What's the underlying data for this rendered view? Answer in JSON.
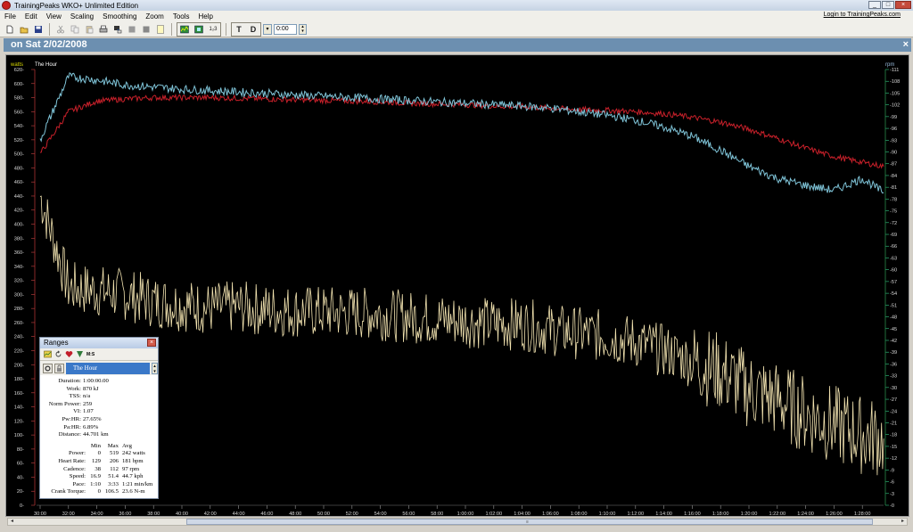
{
  "window": {
    "title": "TrainingPeaks WKO+ Unlimited Edition",
    "controls": [
      "_",
      "□",
      "×"
    ]
  },
  "menu": {
    "items": [
      "File",
      "Edit",
      "View",
      "Scaling",
      "Smoothing",
      "Zoom",
      "Tools",
      "Help"
    ],
    "login_link": "Login to TrainingPeaks.com"
  },
  "toolbar": {
    "time_input": "0:00",
    "t_label": "T",
    "d_label": "D",
    "zoom_label": "1₂3",
    "help_label": "?"
  },
  "panel": {
    "title": "on Sat 2/02/2008",
    "close": "×"
  },
  "chart_labels": {
    "left_unit": "watts",
    "right_unit": "rpm",
    "range_name": "The Hour",
    "left_ticks": [
      "620",
      "600",
      "580",
      "560",
      "540",
      "520",
      "500",
      "480",
      "460",
      "440",
      "420",
      "400",
      "380",
      "360",
      "340",
      "320",
      "300",
      "280",
      "260",
      "240",
      "220",
      "200",
      "180",
      "160",
      "140",
      "120",
      "100",
      "80",
      "60",
      "40",
      "20",
      "0"
    ],
    "right_ticks": [
      "111",
      "108",
      "105",
      "102",
      "99",
      "96",
      "93",
      "90",
      "87",
      "84",
      "81",
      "78",
      "75",
      "72",
      "69",
      "66",
      "63",
      "60",
      "57",
      "54",
      "51",
      "48",
      "45",
      "42",
      "39",
      "36",
      "33",
      "30",
      "27",
      "24",
      "21",
      "18",
      "15",
      "12",
      "9",
      "6",
      "3",
      "0"
    ],
    "x_ticks": [
      "30:00",
      "32:00",
      "34:00",
      "36:00",
      "38:00",
      "40:00",
      "42:00",
      "44:00",
      "46:00",
      "48:00",
      "50:00",
      "52:00",
      "54:00",
      "56:00",
      "58:00",
      "1:00:00",
      "1:02:00",
      "1:04:00",
      "1:06:00",
      "1:08:00",
      "1:10:00",
      "1:12:00",
      "1:14:00",
      "1:16:00",
      "1:18:00",
      "1:20:00",
      "1:22:00",
      "1:24:00",
      "1:26:00",
      "1:28:00"
    ]
  },
  "chart_data": {
    "type": "line",
    "x_unit": "elapsed time",
    "series": [
      {
        "name": "Power",
        "color": "#f2e3b0",
        "axis": "watts",
        "x": [
          "30:00",
          "32:00",
          "34:00",
          "36:00",
          "38:00",
          "40:00",
          "42:00",
          "44:00",
          "46:00",
          "48:00",
          "50:00",
          "52:00",
          "54:00",
          "56:00",
          "58:00",
          "1:00:00",
          "1:02:00",
          "1:04:00",
          "1:06:00",
          "1:08:00",
          "1:10:00",
          "1:12:00",
          "1:14:00",
          "1:16:00",
          "1:18:00",
          "1:20:00",
          "1:22:00",
          "1:24:00",
          "1:26:00",
          "1:28:00",
          "1:29:30"
        ],
        "values": [
          440,
          310,
          305,
          300,
          290,
          285,
          280,
          282,
          278,
          276,
          275,
          274,
          272,
          268,
          265,
          262,
          258,
          258,
          250,
          245,
          240,
          232,
          220,
          205,
          190,
          165,
          150,
          130,
          115,
          100,
          95
        ]
      },
      {
        "name": "Heart Rate",
        "color": "#c8202a",
        "axis": "bpm",
        "x": [
          "30:00",
          "32:00",
          "34:00",
          "36:00",
          "38:00",
          "40:00",
          "42:00",
          "44:00",
          "46:00",
          "48:00",
          "50:00",
          "52:00",
          "54:00",
          "56:00",
          "58:00",
          "1:00:00",
          "1:02:00",
          "1:04:00",
          "1:06:00",
          "1:08:00",
          "1:10:00",
          "1:12:00",
          "1:14:00",
          "1:16:00",
          "1:18:00",
          "1:20:00",
          "1:22:00",
          "1:24:00",
          "1:26:00",
          "1:28:00",
          "1:29:30"
        ],
        "values": [
          500,
          560,
          575,
          578,
          580,
          580,
          580,
          579,
          578,
          577,
          576,
          575,
          574,
          572,
          571,
          570,
          568,
          567,
          565,
          563,
          562,
          560,
          557,
          552,
          545,
          535,
          522,
          508,
          496,
          488,
          482
        ]
      },
      {
        "name": "Speed",
        "color": "#7fc4d8",
        "axis": "kph",
        "x": [
          "30:00",
          "32:00",
          "34:00",
          "36:00",
          "38:00",
          "40:00",
          "42:00",
          "44:00",
          "46:00",
          "48:00",
          "50:00",
          "52:00",
          "54:00",
          "56:00",
          "58:00",
          "1:00:00",
          "1:02:00",
          "1:04:00",
          "1:06:00",
          "1:08:00",
          "1:10:00",
          "1:12:00",
          "1:14:00",
          "1:16:00",
          "1:18:00",
          "1:20:00",
          "1:22:00",
          "1:24:00",
          "1:26:00",
          "1:28:00",
          "1:29:30"
        ],
        "values": [
          520,
          610,
          605,
          598,
          595,
          592,
          590,
          588,
          586,
          584,
          582,
          580,
          578,
          576,
          574,
          572,
          570,
          568,
          565,
          560,
          555,
          548,
          538,
          525,
          505,
          482,
          465,
          455,
          448,
          465,
          445
        ]
      }
    ]
  },
  "ranges": {
    "title": "Ranges",
    "close": "×",
    "tools_label": "M:S",
    "selected": "The Hour",
    "stats": [
      {
        "label": "Duration:",
        "value": "1:00:00.00"
      },
      {
        "label": "Work:",
        "value": "870 kJ"
      },
      {
        "label": "TSS:",
        "value": "n/a"
      },
      {
        "label": "Norm Power:",
        "value": "259"
      },
      {
        "label": "VI:",
        "value": "1.07"
      },
      {
        "label": "Pw:HR:",
        "value": "27.65%"
      },
      {
        "label": "Pa:HR:",
        "value": "6.89%"
      },
      {
        "label": "Distance:",
        "value": "44.701 km"
      }
    ],
    "table_head": {
      "min": "Min",
      "max": "Max",
      "avg": "Avg"
    },
    "table": [
      {
        "label": "Power:",
        "min": "0",
        "max": "519",
        "avg": "242 watts"
      },
      {
        "label": "Heart Rate:",
        "min": "129",
        "max": "206",
        "avg": "181 bpm"
      },
      {
        "label": "Cadence:",
        "min": "38",
        "max": "112",
        "avg": "97 rpm"
      },
      {
        "label": "Speed:",
        "min": "16.9",
        "max": "51.4",
        "avg": "44.7 kph"
      },
      {
        "label": "Pace:",
        "min": "1:10",
        "max": "3:33",
        "avg": "1:21 min/km"
      },
      {
        "label": "Crank Torque:",
        "min": "0",
        "max": "106.5",
        "avg": "23.6 N-m"
      }
    ]
  }
}
